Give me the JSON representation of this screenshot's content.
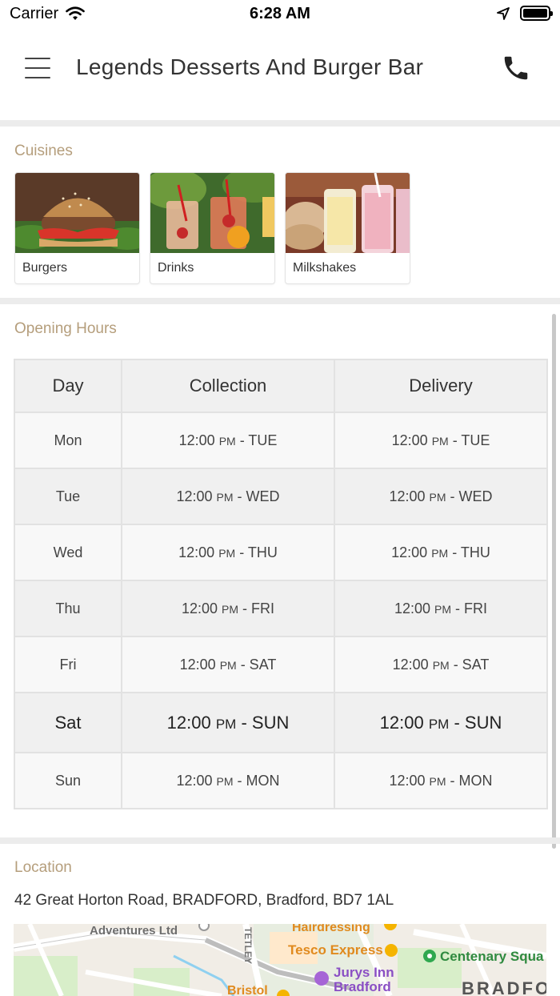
{
  "status_bar": {
    "carrier": "Carrier",
    "time": "6:28 AM"
  },
  "header": {
    "title": "Legends Desserts And Burger Bar",
    "menu_icon": "hamburger-menu-icon",
    "call_icon": "phone-icon"
  },
  "cuisines": {
    "title": "Cuisines",
    "items": [
      {
        "label": "Burgers"
      },
      {
        "label": "Drinks"
      },
      {
        "label": "Milkshakes"
      }
    ]
  },
  "opening_hours": {
    "title": "Opening Hours",
    "columns": [
      "Day",
      "Collection",
      "Delivery"
    ],
    "rows": [
      {
        "day": "Mon",
        "collection_time": "12:00",
        "collection_end": " - TUE",
        "delivery_time": "12:00",
        "delivery_end": " - TUE"
      },
      {
        "day": "Tue",
        "collection_time": "12:00",
        "collection_end": " - WED",
        "delivery_time": "12:00",
        "delivery_end": " - WED"
      },
      {
        "day": "Wed",
        "collection_time": "12:00",
        "collection_end": " - THU",
        "delivery_time": "12:00",
        "delivery_end": " - THU"
      },
      {
        "day": "Thu",
        "collection_time": "12:00",
        "collection_end": " - FRI",
        "delivery_time": "12:00",
        "delivery_end": " - FRI"
      },
      {
        "day": "Fri",
        "collection_time": "12:00",
        "collection_end": " - SAT",
        "delivery_time": "12:00",
        "delivery_end": " - SAT"
      },
      {
        "day": "Sat",
        "collection_time": "12:00",
        "collection_end": " - SUN",
        "delivery_time": "12:00",
        "delivery_end": " - SUN"
      },
      {
        "day": "Sun",
        "collection_time": "12:00",
        "collection_end": " - MON",
        "delivery_time": "12:00",
        "delivery_end": " - MON"
      }
    ],
    "pm_label": "PM"
  },
  "location": {
    "title": "Location",
    "address": "42 Great Horton Road, BRADFORD, Bradford, BD7 1AL",
    "map_labels": {
      "adventures": "Adventures Ltd",
      "hairdressing": "Hairdressing",
      "tesco": "Tesco Express",
      "centenary": "Centenary Squa",
      "jurys": "Jurys Inn",
      "jurys2": "Bradford",
      "bristol": "Bristol",
      "tetley": "TETLEY",
      "bradford": "BRADFOR"
    }
  }
}
